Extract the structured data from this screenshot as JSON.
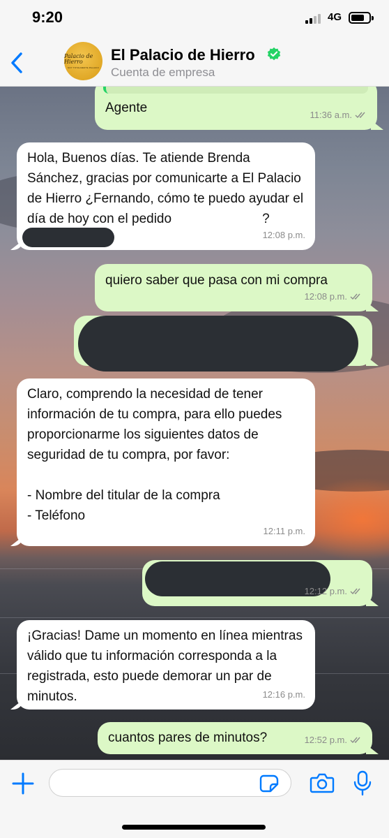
{
  "status_bar": {
    "time": "9:20",
    "network": "4G"
  },
  "header": {
    "contact_name": "El Palacio de Hierro",
    "contact_subtitle": "Cuenta de empresa",
    "avatar_logo": "Palacio de Hierro",
    "avatar_tagline": "SOY TOTALMENTE PALACIO"
  },
  "messages": [
    {
      "text": "Agente",
      "time": "11:36 a.m.",
      "direction": "outgoing",
      "read": true
    },
    {
      "text": "Hola, Buenos días. Te atiende Brenda Sánchez, gracias por comunicarte a El Palacio de Hierro ¿Fernando, cómo te puedo ayudar el día de hoy con el pedido",
      "text_after_redaction": "?",
      "time": "12:08 p.m.",
      "direction": "incoming"
    },
    {
      "text": "quiero saber que pasa con mi compra",
      "time": "12:08 p.m.",
      "direction": "outgoing",
      "read": true
    },
    {
      "text": "",
      "time": "",
      "direction": "outgoing",
      "redacted": true
    },
    {
      "text": "Claro, comprendo la necesidad de tener información de tu compra, para ello puedes proporcionarme los siguientes datos de seguridad de tu compra, por favor:\n\n- Nombre del titular de la compra\n- Teléfono",
      "time": "12:11 p.m.",
      "direction": "incoming"
    },
    {
      "text": "",
      "time": "12:12 p.m.",
      "direction": "outgoing",
      "redacted": true,
      "read": true
    },
    {
      "text": "¡Gracias! Dame un momento en línea mientras válido que tu información corresponda a la registrada, esto puede demorar un par de minutos.",
      "time": "12:16 p.m.",
      "direction": "incoming"
    },
    {
      "text": "cuantos pares de minutos?",
      "time": "12:52 p.m.",
      "direction": "outgoing",
      "read": true
    }
  ],
  "composer": {
    "value": "",
    "placeholder": ""
  },
  "colors": {
    "incoming_bubble": "#ffffff",
    "outgoing_bubble": "#dcf8c6",
    "accent": "#007aff",
    "verified": "#25d366"
  },
  "icons": [
    "back-chevron-icon",
    "verified-badge-icon",
    "double-check-icon",
    "plus-icon",
    "sticker-icon",
    "camera-icon",
    "microphone-icon"
  ]
}
